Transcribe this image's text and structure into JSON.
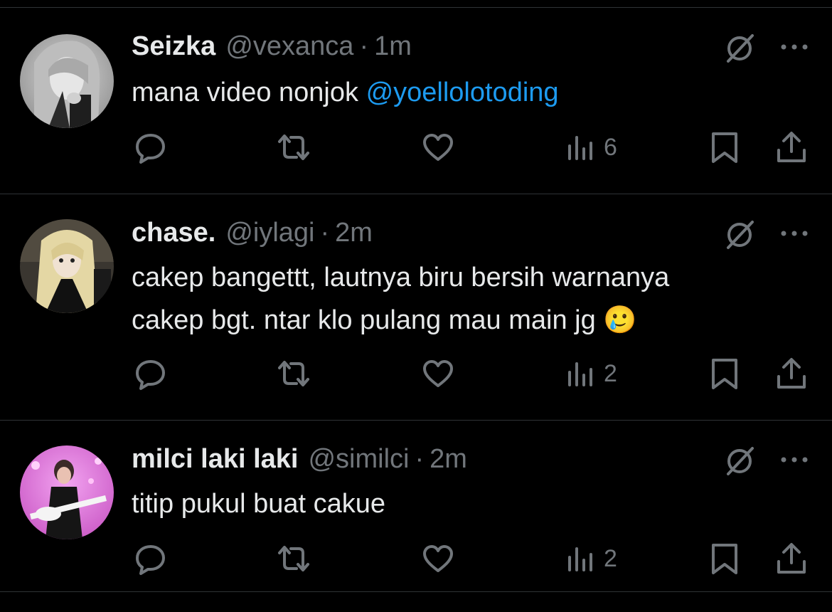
{
  "tweets": [
    {
      "display_name": "Seizka",
      "handle": "@vexanca",
      "time": "1m",
      "text_parts": [
        "mana video nonjok "
      ],
      "mention": "@yoellolotoding",
      "views": "6"
    },
    {
      "display_name": "chase.",
      "handle": "@iylagi",
      "time": "2m",
      "line1": "cakep bangettt, lautnya biru bersih warnanya",
      "line2": "cakep bgt. ntar klo pulang mau main jg ",
      "emoji": "🥲",
      "views": "2"
    },
    {
      "display_name": "milci laki laki",
      "handle": "@similci",
      "time": "2m",
      "text": "titip pukul buat cakue",
      "views": "2"
    }
  ],
  "separator": "·",
  "colors": {
    "background": "#000000",
    "text": "#e7e9ea",
    "secondary": "#71767b",
    "mention": "#1d9bf0",
    "divider": "#2f3336"
  },
  "icons": [
    "grok-icon",
    "more-icon",
    "reply-icon",
    "retweet-icon",
    "like-icon",
    "views-icon",
    "bookmark-icon",
    "share-icon"
  ]
}
